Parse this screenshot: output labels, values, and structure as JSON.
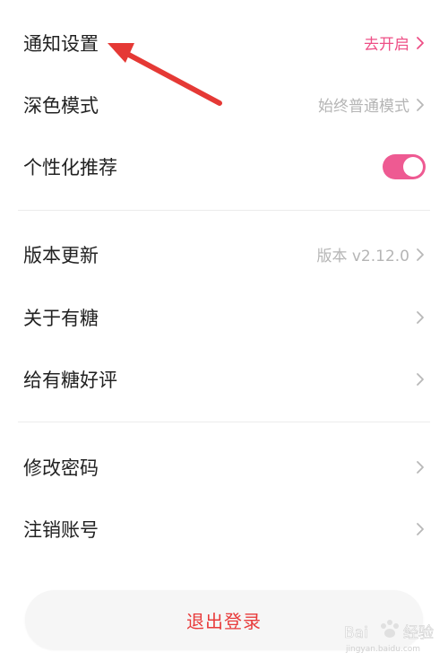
{
  "settings": {
    "section1": [
      {
        "label": "通知设置",
        "value": "去开启",
        "accent": true
      },
      {
        "label": "深色模式",
        "value": "始终普通模式"
      },
      {
        "label": "个性化推荐",
        "toggle": true,
        "toggle_on": true
      }
    ],
    "section2": [
      {
        "label": "版本更新",
        "value": "版本 v2.12.0"
      },
      {
        "label": "关于有糖",
        "value": ""
      },
      {
        "label": "给有糖好评",
        "value": ""
      }
    ],
    "section3": [
      {
        "label": "修改密码",
        "value": ""
      },
      {
        "label": "注销账号",
        "value": ""
      }
    ]
  },
  "logout": {
    "label": "退出登录"
  },
  "colors": {
    "accent": "#ee4f86",
    "logout_text": "#e83b3b",
    "annotation_arrow": "#e53935"
  },
  "icons": {
    "chevron": "chevron-right-icon",
    "arrow": "annotation-arrow-icon"
  },
  "watermark": {
    "text": "Bai 经验",
    "sub": "jingyan.baidu.com"
  }
}
